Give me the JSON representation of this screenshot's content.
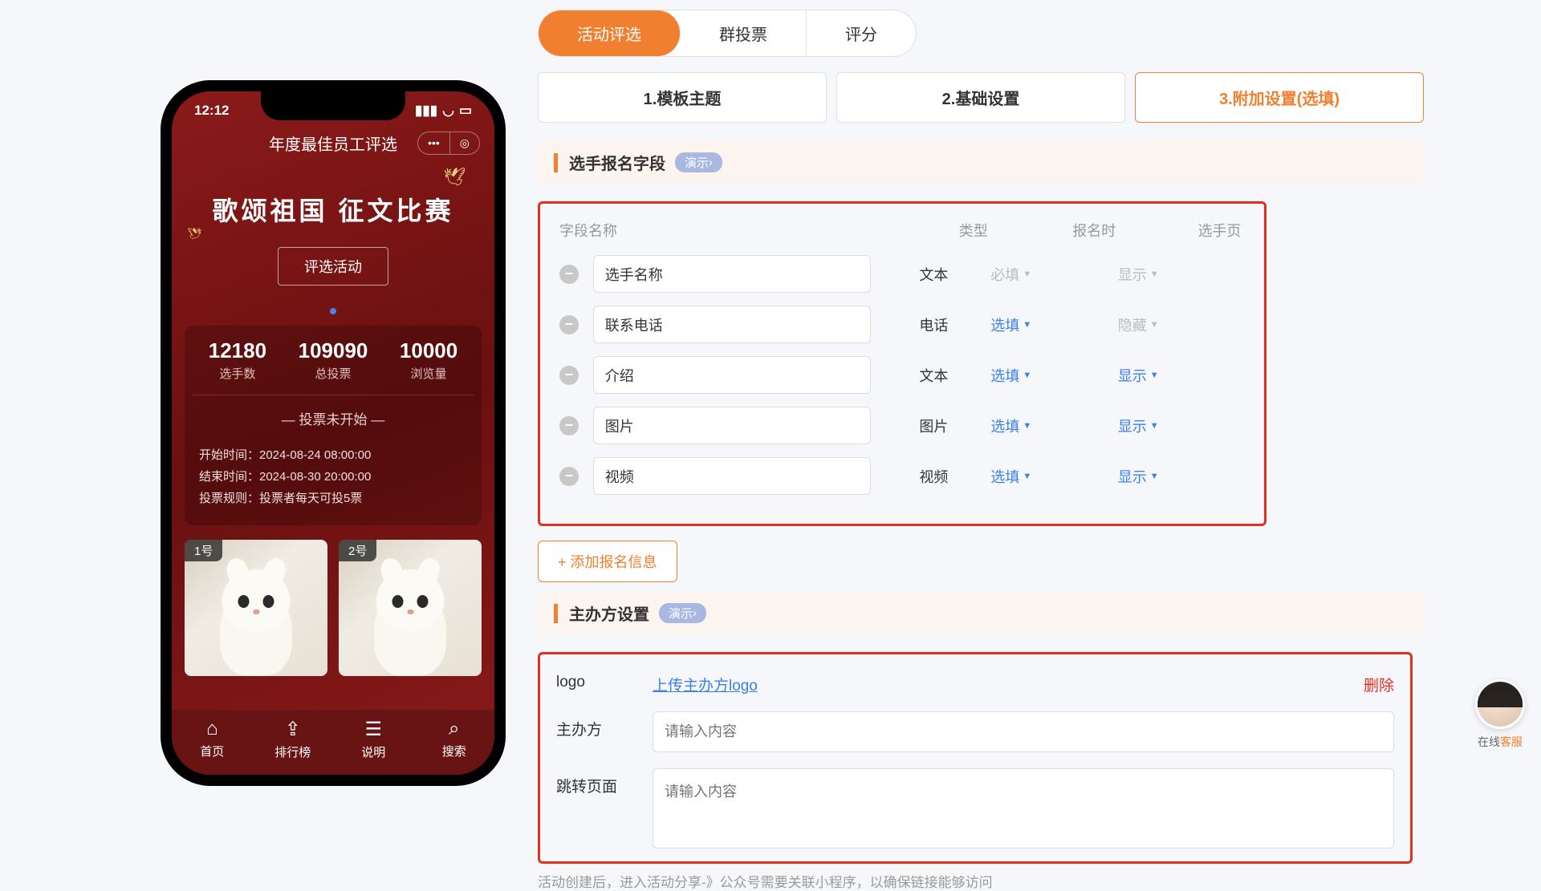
{
  "topTabs": [
    "活动评选",
    "群投票",
    "评分"
  ],
  "stepTabs": [
    "1.模板主题",
    "2.基础设置",
    "3.附加设置(选填)"
  ],
  "fieldsSection": {
    "title": "选手报名字段",
    "demo": "演示",
    "headers": {
      "name": "字段名称",
      "type": "类型",
      "reg": "报名时",
      "show": "选手页"
    },
    "rows": [
      {
        "name": "选手名称",
        "type": "文本",
        "reg": "必填",
        "regClass": "gray",
        "show": "显示",
        "showClass": "gray"
      },
      {
        "name": "联系电话",
        "type": "电话",
        "reg": "选填",
        "regClass": "blue",
        "show": "隐藏",
        "showClass": "gray"
      },
      {
        "name": "介绍",
        "type": "文本",
        "reg": "选填",
        "regClass": "blue",
        "show": "显示",
        "showClass": "blue"
      },
      {
        "name": "图片",
        "type": "图片",
        "reg": "选填",
        "regClass": "blue",
        "show": "显示",
        "showClass": "blue"
      },
      {
        "name": "视频",
        "type": "视频",
        "reg": "选填",
        "regClass": "blue",
        "show": "显示",
        "showClass": "blue"
      }
    ],
    "addBtn": "+ 添加报名信息"
  },
  "organizerSection": {
    "title": "主办方设置",
    "demo": "演示",
    "logoLabel": "logo",
    "uploadLink": "上传主办方logo",
    "deleteLink": "删除",
    "orgLabel": "主办方",
    "orgPlaceholder": "请输入内容",
    "jumpLabel": "跳转页面",
    "jumpPlaceholder": "请输入内容",
    "hint": "活动创建后，进入活动分享-》公众号需要关联小程序，以确保链接能够访问"
  },
  "phone": {
    "time": "12:12",
    "appTitle": "年度最佳员工评选",
    "heroTitle": "歌颂祖国 征文比赛",
    "heroBtn": "评选活动",
    "stats": [
      {
        "num": "12180",
        "label": "选手数"
      },
      {
        "num": "109090",
        "label": "总投票"
      },
      {
        "num": "10000",
        "label": "浏览量"
      }
    ],
    "voteStatus": "— 投票未开始 —",
    "info": [
      "开始时间：2024-08-24 08:00:00",
      "结束时间：2024-08-30 20:00:00",
      "投票规则：投票者每天可投5票"
    ],
    "contestants": [
      "1号",
      "2号"
    ],
    "nav": [
      {
        "icon": "⌂",
        "label": "首页"
      },
      {
        "icon": "⇪",
        "label": "排行榜"
      },
      {
        "icon": "☰",
        "label": "说明"
      },
      {
        "icon": "⌕",
        "label": "搜索"
      }
    ]
  },
  "cs": {
    "label1": "在线",
    "label2": "客服"
  }
}
